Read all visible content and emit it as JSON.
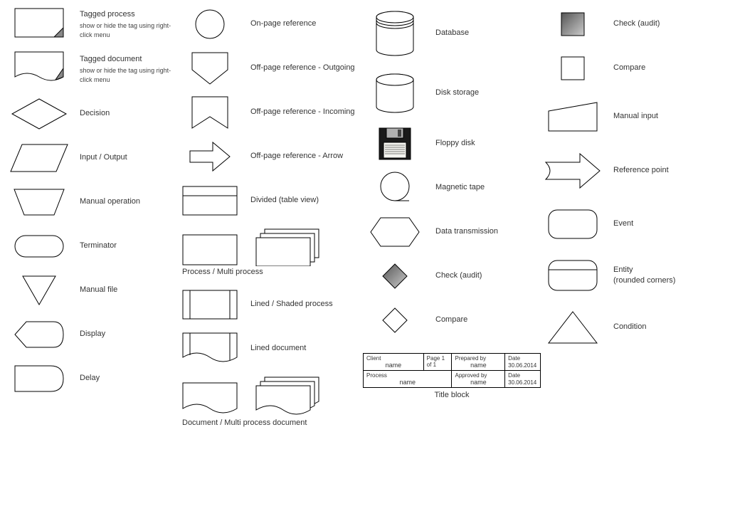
{
  "col1": {
    "taggedProcess": {
      "label": "Tagged process",
      "sub": "show or hide the tag using right-click menu"
    },
    "taggedDocument": {
      "label": "Tagged document",
      "sub": "show or hide the tag using right-click menu"
    },
    "decision": "Decision",
    "inputOutput": "Input / Output",
    "manualOperation": "Manual operation",
    "terminator": "Terminator",
    "manualFile": "Manual file",
    "display": "Display",
    "delay": "Delay"
  },
  "col2": {
    "onPageRef": "On-page reference",
    "offPageOut": "Off-page reference - Outgoing",
    "offPageIn": "Off-page reference - Incoming",
    "offPageArrow": "Off-page reference - Arrow",
    "divided": "Divided (table view)",
    "processMulti": "Process / Multi process",
    "linedShaded": "Lined / Shaded process",
    "linedDoc": "Lined document",
    "docMulti": "Document / Multi process document"
  },
  "col3": {
    "database": "Database",
    "diskStorage": "Disk storage",
    "floppyDisk": "Floppy disk",
    "magneticTape": "Magnetic tape",
    "dataTransmission": "Data transmission",
    "checkAudit": "Check (audit)",
    "compare": "Compare"
  },
  "col4": {
    "checkAudit": "Check (audit)",
    "compare": "Compare",
    "manualInput": "Manual input",
    "refPoint": "Reference point",
    "event": "Event",
    "entity": "Entity",
    "entitySub": "(rounded corners)",
    "condition": "Condition"
  },
  "titleBlock": {
    "client": "Client",
    "clientName": "name",
    "page": "Page",
    "pageNum": "1",
    "pageOf": "of",
    "pageTotal": "1",
    "prepared": "Prepared by",
    "preparedName": "name",
    "date1Label": "Date",
    "date1": "30.06.2014",
    "process": "Process",
    "processName": "name",
    "approved": "Approved by",
    "approvedName": "name",
    "date2Label": "Date",
    "date2": "30.06.2014",
    "caption": "Title block"
  }
}
